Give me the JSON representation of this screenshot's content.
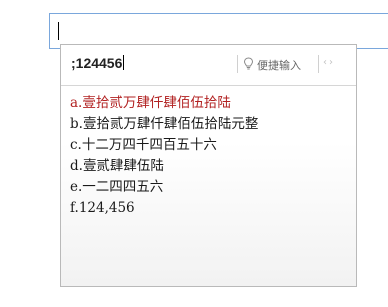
{
  "composition": {
    "text": ";124456"
  },
  "quick_input": {
    "label": "便捷输入",
    "icon": "lightbulb-icon"
  },
  "page_nav": {
    "prev": "‹",
    "next": "›"
  },
  "candidates": [
    {
      "key": "a.",
      "text": "壹拾贰万肆仟肆佰伍拾陆",
      "selected": true
    },
    {
      "key": "b.",
      "text": "壹拾贰万肆仟肆佰伍拾陆元整"
    },
    {
      "key": "c.",
      "text": "十二万四千四百五十六"
    },
    {
      "key": "d.",
      "text": "壹贰肆肆伍陆"
    },
    {
      "key": "e.",
      "text": "一二四四五六"
    },
    {
      "key": "f.",
      "text": "124,456"
    }
  ],
  "colors": {
    "selected": "#b22222",
    "border": "#7aa7dc"
  }
}
